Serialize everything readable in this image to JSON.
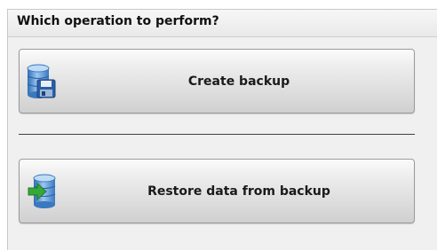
{
  "panel": {
    "title": "Which operation to perform?"
  },
  "operations": [
    {
      "label": "Create backup",
      "icon": "database-save-icon"
    },
    {
      "label": "Restore data from backup",
      "icon": "database-restore-icon"
    }
  ],
  "colors": {
    "panel_bg": "#f0f0f0",
    "button_border": "#9a9a9a",
    "database_blue": "#4a86c8",
    "floppy_blue": "#2a5fa8",
    "restore_arrow_green": "#36a83a"
  }
}
